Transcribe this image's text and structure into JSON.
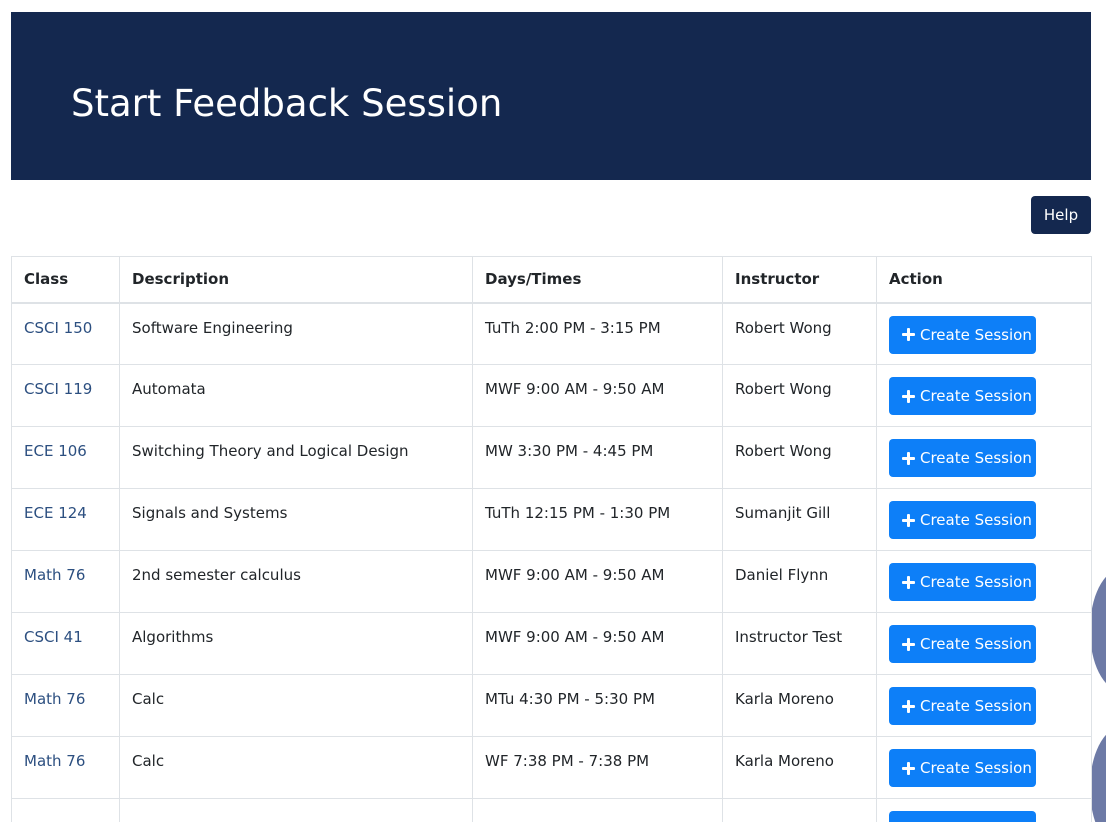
{
  "banner": {
    "title": "Start Feedback Session"
  },
  "toolbar": {
    "help_label": "Help"
  },
  "table": {
    "headers": {
      "class": "Class",
      "description": "Description",
      "days_times": "Days/Times",
      "instructor": "Instructor",
      "action": "Action"
    },
    "rows": [
      {
        "class": "CSCI 150",
        "description": "Software Engineering",
        "days_times": "TuTh 2:00 PM - 3:15 PM",
        "instructor": "Robert Wong",
        "action": "Create Session"
      },
      {
        "class": "CSCI 119",
        "description": "Automata",
        "days_times": "MWF 9:00 AM - 9:50 AM",
        "instructor": "Robert Wong",
        "action": "Create Session"
      },
      {
        "class": "ECE 106",
        "description": "Switching Theory and Logical Design",
        "days_times": "MW 3:30 PM - 4:45 PM",
        "instructor": "Robert Wong",
        "action": "Create Session"
      },
      {
        "class": "ECE 124",
        "description": "Signals and Systems",
        "days_times": "TuTh 12:15 PM - 1:30 PM",
        "instructor": "Sumanjit Gill",
        "action": "Create Session"
      },
      {
        "class": "Math 76",
        "description": "2nd semester calculus",
        "days_times": "MWF 9:00 AM - 9:50 AM",
        "instructor": "Daniel Flynn",
        "action": "Create Session"
      },
      {
        "class": "CSCI 41",
        "description": "Algorithms",
        "days_times": "MWF 9:00 AM - 9:50 AM",
        "instructor": "Instructor Test",
        "action": "Create Session"
      },
      {
        "class": "Math 76",
        "description": "Calc",
        "days_times": "MTu 4:30 PM - 5:30 PM",
        "instructor": "Karla Moreno",
        "action": "Create Session"
      },
      {
        "class": "Math 76",
        "description": "Calc",
        "days_times": "WF 7:38 PM - 7:38 PM",
        "instructor": "Karla Moreno",
        "action": "Create Session"
      },
      {
        "class": "",
        "description": "",
        "days_times": "",
        "instructor": "",
        "action": ""
      }
    ]
  },
  "icons": {
    "create_button_icon": "plus-icon"
  },
  "colors": {
    "banner_bg": "#14284f",
    "help_button_bg": "#14284f",
    "primary_button_bg": "#0d7ff8",
    "class_link": "#2c4f80"
  }
}
